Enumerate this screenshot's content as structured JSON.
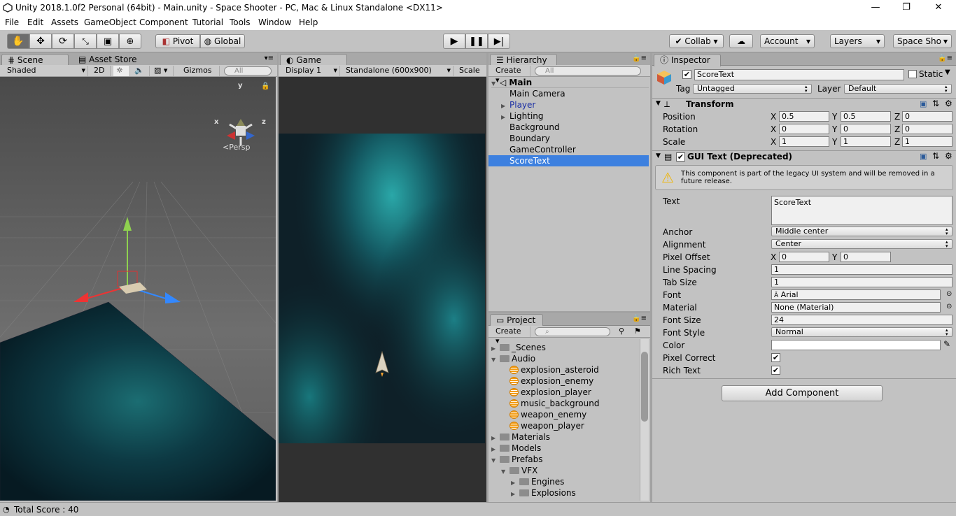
{
  "window": {
    "title": "Unity 2018.1.0f2 Personal (64bit) - Main.unity - Space Shooter - PC, Mac & Linux Standalone <DX11>",
    "minimize": "—",
    "restore": "❐",
    "close": "✕"
  },
  "menu": [
    "File",
    "Edit",
    "Assets",
    "GameObject",
    "Component",
    "Tutorial",
    "Tools",
    "Window",
    "Help"
  ],
  "toolbar": {
    "pivot": "Pivot",
    "global": "Global",
    "collab": "Collab",
    "account": "Account",
    "layers": "Layers",
    "layout": "Space Sho"
  },
  "scene": {
    "tab": "Scene",
    "store_tab": "Asset Store",
    "shading": "Shaded",
    "mode2d": "2D",
    "gizmos": "Gizmos",
    "search_placeholder": "All",
    "persp": "Persp",
    "axis_y": "y",
    "axis_x": "x",
    "axis_z": "z"
  },
  "game": {
    "tab": "Game",
    "display": "Display 1",
    "resolution": "Standalone (600x900)",
    "scale": "Scale"
  },
  "hierarchy": {
    "tab": "Hierarchy",
    "create": "Create",
    "search_placeholder": "All",
    "scene": "Main",
    "items": [
      "Main Camera",
      "Player",
      "Lighting",
      "Background",
      "Boundary",
      "GameController",
      "ScoreText"
    ]
  },
  "project": {
    "tab": "Project",
    "create": "Create",
    "items": [
      "_Scenes",
      "Audio",
      "explosion_asteroid",
      "explosion_enemy",
      "explosion_player",
      "music_background",
      "weapon_enemy",
      "weapon_player",
      "Materials",
      "Models",
      "Prefabs",
      "VFX",
      "Engines",
      "Explosions"
    ]
  },
  "inspector": {
    "tab": "Inspector",
    "name": "ScoreText",
    "static": "Static",
    "tag_label": "Tag",
    "tag": "Untagged",
    "layer_label": "Layer",
    "layer": "Default",
    "transform": {
      "title": "Transform",
      "position_label": "Position",
      "rotation_label": "Rotation",
      "scale_label": "Scale",
      "x": "X",
      "y": "Y",
      "z": "Z",
      "position": [
        "0.5",
        "0.5",
        "0"
      ],
      "rotation": [
        "0",
        "0",
        "0"
      ],
      "scale": [
        "1",
        "1",
        "1"
      ]
    },
    "guitext": {
      "title": "GUI Text (Deprecated)",
      "warning": "This component is part of the legacy UI system and will be removed in a future release.",
      "text_label": "Text",
      "text": "ScoreText",
      "anchor_label": "Anchor",
      "anchor": "Middle center",
      "alignment_label": "Alignment",
      "alignment": "Center",
      "pixel_offset_label": "Pixel Offset",
      "pixel_offset": [
        "0",
        "0"
      ],
      "line_spacing_label": "Line Spacing",
      "line_spacing": "1",
      "tab_size_label": "Tab Size",
      "tab_size": "1",
      "font_label": "Font",
      "font": "Arial",
      "material_label": "Material",
      "material": "None (Material)",
      "font_size_label": "Font Size",
      "font_size": "24",
      "font_style_label": "Font Style",
      "font_style": "Normal",
      "color_label": "Color",
      "pixel_correct_label": "Pixel Correct",
      "rich_text_label": "Rich Text"
    },
    "add_component": "Add Component"
  },
  "status": "Total Score : 40"
}
